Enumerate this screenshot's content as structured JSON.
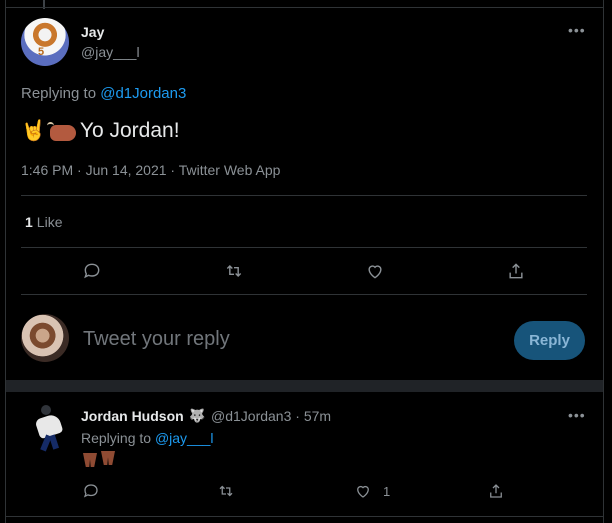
{
  "main_tweet": {
    "display_name": "Jay",
    "handle": "@jay___l",
    "replying_label": "Replying to",
    "replying_handle": "@d1Jordan3",
    "text": "Yo Jordan!",
    "emoji": [
      "🤘",
      "🐂"
    ],
    "timestamp": "1:46 PM · Jun 14, 2021 · Twitter Web App",
    "like_count": "1",
    "like_label": "Like",
    "avatar_number": "5"
  },
  "composer": {
    "placeholder": "Tweet your reply",
    "reply_button": "Reply"
  },
  "reply_tweet": {
    "display_name": "Jordan Hudson",
    "handle_time": "@d1Jordan3 · 57m",
    "replying_label": "Replying to",
    "replying_handle": "@jay___l",
    "emoji": [
      "🐾"
    ],
    "like_count": "1"
  },
  "icons": {
    "more": "ellipsis-icon",
    "reply": "reply-icon",
    "retweet": "retweet-icon",
    "like": "heart-icon",
    "share": "share-icon"
  },
  "colors": {
    "accent": "#1d9bf0",
    "reply_button": "#17547a",
    "background": "#000000"
  }
}
